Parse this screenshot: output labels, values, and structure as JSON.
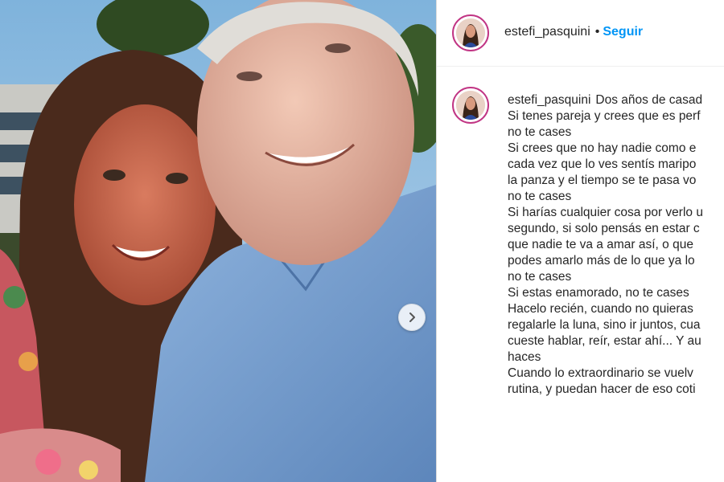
{
  "post": {
    "username": "estefi_pasquini",
    "separator": "•",
    "follow_label": "Seguir"
  },
  "caption": {
    "username": "estefi_pasquini",
    "text": "Dos años de casad\nSi tenes pareja y crees que es perf\nno te cases\nSi crees que no hay nadie como e\ncada vez que lo ves sentís maripo\nla panza y el tiempo se te pasa vo\nno te cases\nSi harías cualquier cosa por verlo u\nsegundo, si solo pensás en estar c\nque nadie te va a amar así, o que\npodes amarlo más de lo que ya lo\nno te cases\nSi estas enamorado, no te cases\nHacelo recién, cuando no quieras\nregalarle la luna, sino ir juntos, cua\ncueste hablar, reír, estar ahí... Y au\nhaces\nCuando lo extraordinario se vuelv\nrutina, y puedan hacer de eso coti"
  },
  "icons": {
    "carousel_next": "chevron-right-icon"
  },
  "colors": {
    "follow": "#0095f6",
    "avatar_ring": "#c13584",
    "text": "#262626"
  }
}
